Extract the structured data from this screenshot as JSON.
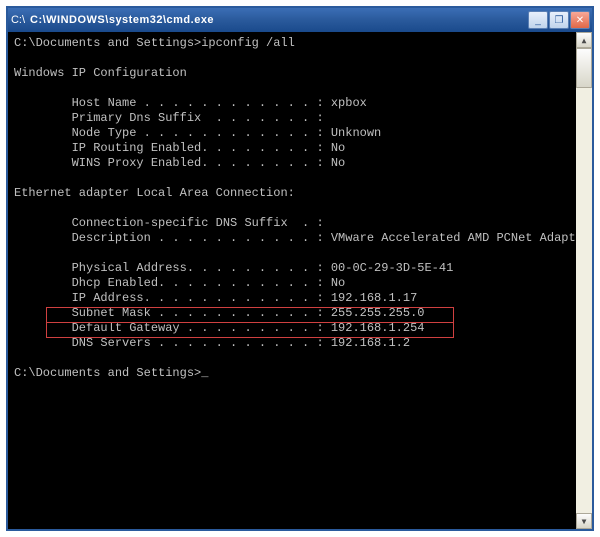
{
  "titlebar": {
    "icon_glyph": "C:\\",
    "title": "C:\\WINDOWS\\system32\\cmd.exe",
    "min_label": "_",
    "max_label": "❐",
    "close_label": "✕"
  },
  "terminal": {
    "prompt1": "C:\\Documents and Settings>",
    "command": "ipconfig /all",
    "header": "Windows IP Configuration",
    "host_config": [
      {
        "label": "Host Name . . . . . . . . . . . . :",
        "value": "xpbox"
      },
      {
        "label": "Primary Dns Suffix  . . . . . . . :",
        "value": ""
      },
      {
        "label": "Node Type . . . . . . . . . . . . :",
        "value": "Unknown"
      },
      {
        "label": "IP Routing Enabled. . . . . . . . :",
        "value": "No"
      },
      {
        "label": "WINS Proxy Enabled. . . . . . . . :",
        "value": "No"
      }
    ],
    "adapter_header": "Ethernet adapter Local Area Connection:",
    "adapter_config": [
      {
        "label": "Connection-specific DNS Suffix  . :",
        "value": ""
      },
      {
        "label": "Description . . . . . . . . . . . :",
        "value": "VMware Accelerated AMD PCNet Adapter"
      },
      {
        "label": "",
        "value": ""
      },
      {
        "label": "Physical Address. . . . . . . . . :",
        "value": "00-0C-29-3D-5E-41"
      },
      {
        "label": "Dhcp Enabled. . . . . . . . . . . :",
        "value": "No"
      },
      {
        "label": "IP Address. . . . . . . . . . . . :",
        "value": "192.168.1.17"
      },
      {
        "label": "Subnet Mask . . . . . . . . . . . :",
        "value": "255.255.255.0"
      },
      {
        "label": "Default Gateway . . . . . . . . . :",
        "value": "192.168.1.254"
      },
      {
        "label": "DNS Servers . . . . . . . . . . . :",
        "value": "192.168.1.2"
      }
    ],
    "prompt2": "C:\\Documents and Settings>",
    "cursor": "_"
  },
  "scrollbar": {
    "up": "▲",
    "down": "▼"
  }
}
